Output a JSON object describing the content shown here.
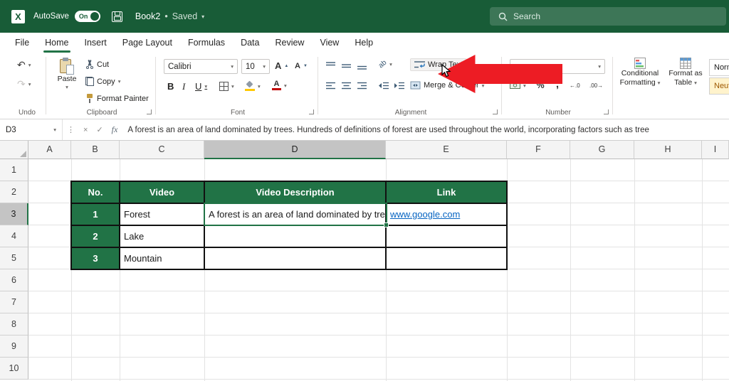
{
  "colors": {
    "titlebar_green": "#185C37",
    "accent_green": "#217346",
    "table_header_green": "#217346",
    "hyperlink_blue": "#0563C1",
    "annotation_arrow_red": "#ED1C24",
    "neutral_style_text": "#9C5700"
  },
  "titlebar": {
    "autosave_label": "AutoSave",
    "autosave_state": "On",
    "workbook_name": "Book2",
    "separator": "•",
    "saved_status": "Saved",
    "search_placeholder": "Search"
  },
  "menu": {
    "items": [
      "File",
      "Home",
      "Insert",
      "Page Layout",
      "Formulas",
      "Data",
      "Review",
      "View",
      "Help"
    ],
    "active_item": "Home"
  },
  "ribbon": {
    "undo_group": {
      "label": "Undo"
    },
    "clipboard_group": {
      "label": "Clipboard",
      "paste": "Paste",
      "cut": "Cut",
      "copy": "Copy",
      "format_painter": "Format Painter"
    },
    "font_group": {
      "label": "Font",
      "font_name": "Calibri",
      "font_size": "10",
      "bold": "B",
      "italic": "I",
      "underline": "U"
    },
    "alignment_group": {
      "label": "Alignment",
      "wrap_text": "Wrap Text",
      "merge_center": "Merge & Center",
      "orientation": "ab"
    },
    "number_group": {
      "label": "Number",
      "percent": "%",
      "comma": ",",
      "increase_decimal": "←.0",
      "decrease_decimal": ".00→"
    },
    "styles_group": {
      "conditional_line1": "Conditional",
      "conditional_line2": "Formatting",
      "format_table_line1": "Format as",
      "format_table_line2": "Table",
      "style_normal": "Normal",
      "style_neutral": "Neutral"
    }
  },
  "formula_bar": {
    "name_box": "D3",
    "fx": "fx",
    "formula": "A forest is an area of land dominated by trees. Hundreds of definitions of forest are used throughout the world, incorporating factors such as tree"
  },
  "grid": {
    "column_headers": [
      "A",
      "B",
      "C",
      "D",
      "E",
      "F",
      "G",
      "H",
      "I"
    ],
    "row_headers": [
      "1",
      "2",
      "3",
      "4",
      "5",
      "6",
      "7",
      "8",
      "9",
      "10"
    ],
    "active_cell": "D3"
  },
  "sheet_table": {
    "header": {
      "no": "No.",
      "video": "Video",
      "description": "Video Description",
      "link": "Link"
    },
    "rows": [
      {
        "no": "1",
        "video": "Forest",
        "link": "www.google.com"
      },
      {
        "no": "2",
        "video": "Lake",
        "link": ""
      },
      {
        "no": "3",
        "video": "Mountain",
        "link": ""
      }
    ]
  }
}
